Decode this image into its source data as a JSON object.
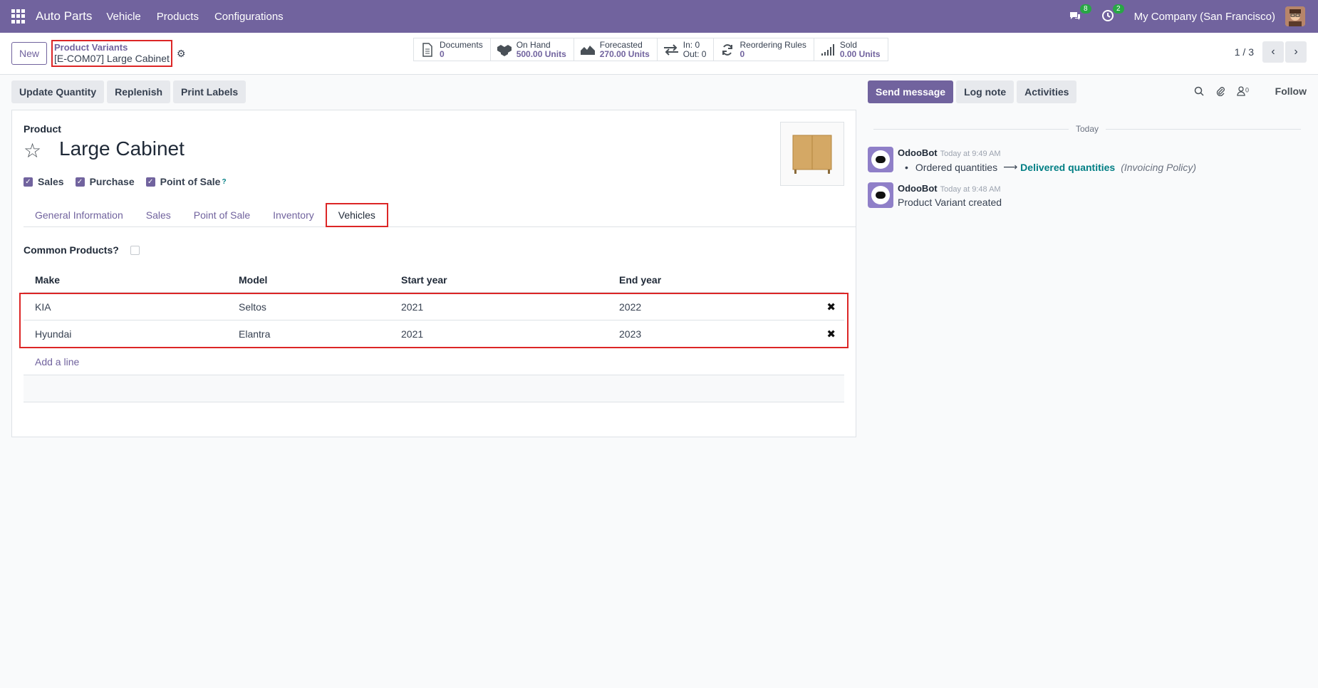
{
  "navbar": {
    "brand": "Auto Parts",
    "menu": [
      "Vehicle",
      "Products",
      "Configurations"
    ],
    "messages_badge": "8",
    "activities_badge": "2",
    "company": "My Company (San Francisco)"
  },
  "control_panel": {
    "new_label": "New",
    "breadcrumb_parent": "Product Variants",
    "breadcrumb_current": "[E-COM07] Large Cabinet",
    "pager": "1 / 3"
  },
  "smart_buttons": [
    {
      "label": "Documents",
      "value": "0",
      "icon": "document-icon"
    },
    {
      "label": "On Hand",
      "value": "500.00 Units",
      "icon": "cubes-icon"
    },
    {
      "label": "Forecasted",
      "value": "270.00 Units",
      "icon": "area-chart-icon"
    },
    {
      "label": "In: 0",
      "value": "Out: 0",
      "icon": "exchange-icon"
    },
    {
      "label": "Reordering Rules",
      "value": "0",
      "icon": "refresh-icon"
    },
    {
      "label": "Sold",
      "value": "0.00 Units",
      "icon": "signal-icon"
    }
  ],
  "actions": {
    "update_quantity": "Update Quantity",
    "replenish": "Replenish",
    "print_labels": "Print Labels"
  },
  "form": {
    "product_label": "Product",
    "product_name": "Large Cabinet",
    "checks": {
      "sales": "Sales",
      "purchase": "Purchase",
      "pos": "Point of Sale",
      "pos_help": "?"
    },
    "tabs": [
      "General Information",
      "Sales",
      "Point of Sale",
      "Inventory",
      "Vehicles"
    ],
    "active_tab": "Vehicles",
    "common_products_label": "Common Products?"
  },
  "vehicles_table": {
    "headers": {
      "make": "Make",
      "model": "Model",
      "start": "Start year",
      "end": "End year"
    },
    "rows": [
      {
        "make": "KIA",
        "model": "Seltos",
        "start": "2021",
        "end": "2022"
      },
      {
        "make": "Hyundai",
        "model": "Elantra",
        "start": "2021",
        "end": "2023"
      }
    ],
    "add_line": "Add a line"
  },
  "chatter": {
    "send_message": "Send message",
    "log_note": "Log note",
    "activities": "Activities",
    "followers_count": "0",
    "follow": "Follow",
    "separator": "Today",
    "messages": [
      {
        "author": "OdooBot",
        "time": "Today at 9:49 AM",
        "old_value": "Ordered quantities",
        "arrow": "⟶",
        "new_value": "Delivered quantities",
        "field": "(Invoicing Policy)"
      },
      {
        "author": "OdooBot",
        "time": "Today at 9:48 AM",
        "body": "Product Variant created"
      }
    ]
  },
  "colors": {
    "brand": "#71639e",
    "highlight": "#dc2626",
    "link": "#017e84"
  }
}
